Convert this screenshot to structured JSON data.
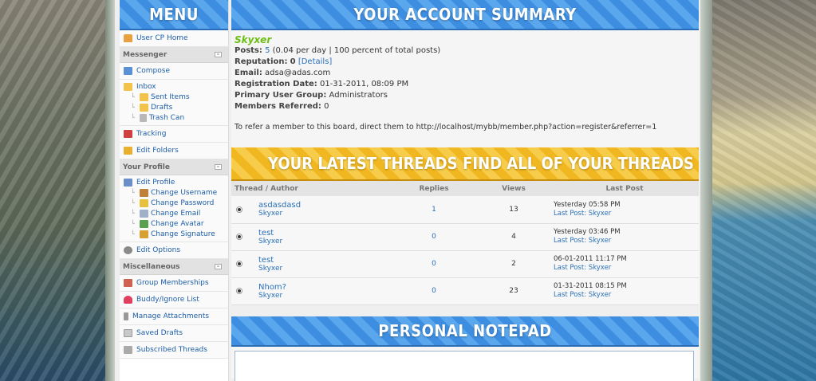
{
  "menu": {
    "title": "MENU",
    "usercp_home": "User CP Home",
    "sections": {
      "messenger": "Messenger",
      "profile": "Your Profile",
      "misc": "Miscellaneous"
    },
    "compose": "Compose",
    "inbox": "Inbox",
    "sent_items": "Sent Items",
    "drafts": "Drafts",
    "trash_can": "Trash Can",
    "tracking": "Tracking",
    "edit_folders": "Edit Folders",
    "edit_profile": "Edit Profile",
    "change_username": "Change Username",
    "change_password": "Change Password",
    "change_email": "Change Email",
    "change_avatar": "Change Avatar",
    "change_signature": "Change Signature",
    "edit_options": "Edit Options",
    "group_memberships": "Group Memberships",
    "buddy_ignore": "Buddy/Ignore List",
    "manage_attachments": "Manage Attachments",
    "saved_drafts": "Saved Drafts",
    "subscribed_threads": "Subscribed Threads",
    "collapse_symbol": "–"
  },
  "summary": {
    "title": "YOUR ACCOUNT SUMMARY",
    "username": "Skyxer",
    "posts_label": "Posts:",
    "posts_count": "5",
    "posts_stats": "(0.04 per day | 100 percent of total posts)",
    "reputation_label": "Reputation:",
    "reputation_value": "0",
    "details_link": "[Details]",
    "email_label": "Email:",
    "email_value": "adsa@adas.com",
    "regdate_label": "Registration Date:",
    "regdate_value": "01-31-2011, 08:09 PM",
    "group_label": "Primary User Group:",
    "group_value": "Administrators",
    "referred_label": "Members Referred:",
    "referred_value": "0",
    "refer_text": "To refer a member to this board, direct them to http://localhost/mybb/member.php?action=register&referrer=1"
  },
  "threads": {
    "title_left": "YOUR LATEST THREADS",
    "title_right": "FIND ALL OF YOUR THREADS",
    "col_thread": "Thread / Author",
    "col_replies": "Replies",
    "col_views": "Views",
    "col_lastpost": "Last Post",
    "last_post_prefix": "Last Post:",
    "rows": [
      {
        "title": "asdasdasd",
        "author": "Skyxer",
        "replies": "1",
        "views": "13",
        "date": "Yesterday 05:58 PM",
        "last_user": "Skyxer"
      },
      {
        "title": "test",
        "author": "Skyxer",
        "replies": "0",
        "views": "4",
        "date": "Yesterday 03:46 PM",
        "last_user": "Skyxer"
      },
      {
        "title": "test",
        "author": "Skyxer",
        "replies": "0",
        "views": "2",
        "date": "06-01-2011 11:17 PM",
        "last_user": "Skyxer"
      },
      {
        "title": "Nhom?",
        "author": "Skyxer",
        "replies": "0",
        "views": "23",
        "date": "01-31-2011 08:15 PM",
        "last_user": "Skyxer"
      }
    ]
  },
  "notepad": {
    "title": "PERSONAL NOTEPAD"
  },
  "colors": {
    "banner_blue": "#3d8de0",
    "banner_gold": "#f0b720",
    "link": "#2a70b8",
    "username_green": "#6cbf12"
  }
}
